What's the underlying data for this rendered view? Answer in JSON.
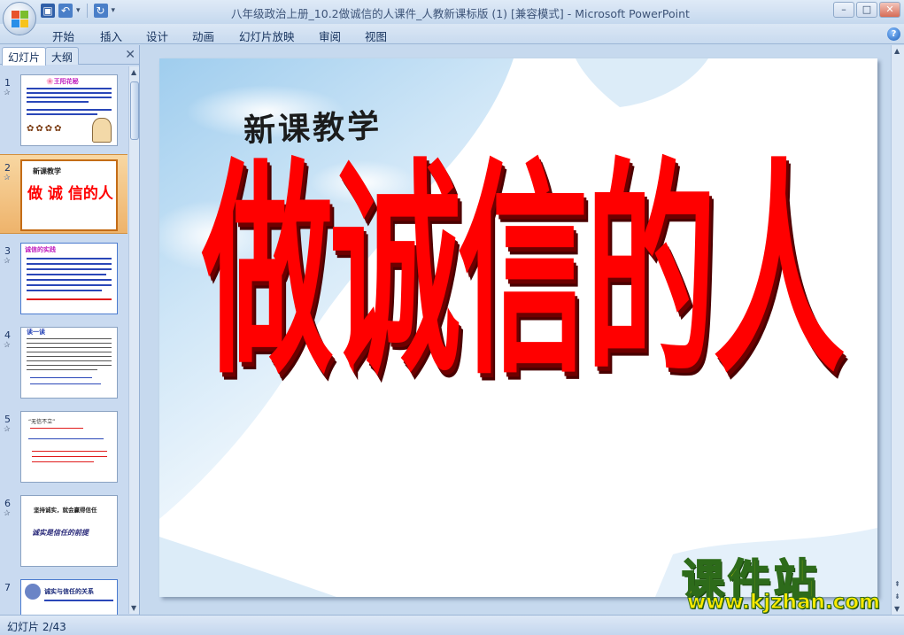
{
  "window": {
    "title": "八年级政治上册_10.2做诚信的人课件_人教新课标版 (1) [兼容模式] - Microsoft PowerPoint",
    "minimize": "–",
    "maximize": "□",
    "close": "✕"
  },
  "quick_access": {
    "save_icon": "save-icon",
    "undo_icon": "undo-icon",
    "redo_icon": "redo-icon"
  },
  "ribbon": {
    "tabs": [
      "开始",
      "插入",
      "设计",
      "动画",
      "幻灯片放映",
      "审阅",
      "视图"
    ],
    "help": "?"
  },
  "panel": {
    "tabs": [
      "幻灯片",
      "大纲"
    ],
    "close": "✕",
    "thumbnails": [
      {
        "number": "1",
        "title": "🌸王阳花秘"
      },
      {
        "number": "2",
        "title": "做 诚 信的人",
        "subtitle": "新课教学"
      },
      {
        "number": "3",
        "title": "诚信的实践"
      },
      {
        "number": "4",
        "title": "读一读"
      },
      {
        "number": "5",
        "title": "“无信不立”"
      },
      {
        "number": "6",
        "title": "诚实是信任的前提",
        "subtitle": "坚持诚实，就会赢得信任"
      },
      {
        "number": "7",
        "title": "诚实与信任的关系"
      }
    ],
    "selected_index": 1
  },
  "slide": {
    "subtitle": "新课教学",
    "title": "做诚信的人"
  },
  "watermark": {
    "line1": "课件站",
    "line2": "www.kjzhan.com"
  },
  "status": {
    "text": "幻灯片 2/43"
  },
  "colors": {
    "title_red": "#ff0000",
    "ribbon_blue": "#c8daef",
    "selection_orange": "#eeb36b"
  }
}
